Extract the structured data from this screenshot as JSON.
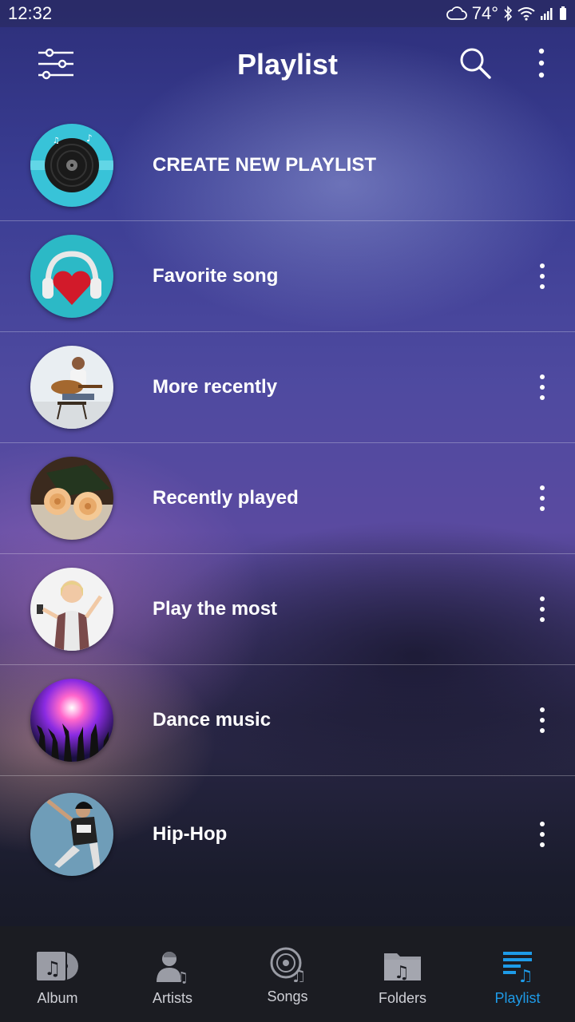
{
  "status_bar": {
    "time": "12:32",
    "temperature": "74°"
  },
  "header": {
    "title": "Playlist"
  },
  "playlists": [
    {
      "label": "CREATE NEW PLAYLIST",
      "icon": "vinyl-record-icon",
      "has_menu": false
    },
    {
      "label": "Favorite song",
      "icon": "heart-headphones-icon",
      "has_menu": true
    },
    {
      "label": "More recently",
      "icon": "guitarist-photo",
      "has_menu": true
    },
    {
      "label": "Recently played",
      "icon": "roses-photo",
      "has_menu": true
    },
    {
      "label": "Play the most",
      "icon": "singer-photo",
      "has_menu": true
    },
    {
      "label": "Dance music",
      "icon": "dance-crowd-photo",
      "has_menu": true
    },
    {
      "label": "Hip-Hop",
      "icon": "hiphop-dancer-photo",
      "has_menu": true
    }
  ],
  "bottom_nav": [
    {
      "label": "Album",
      "icon": "album-icon",
      "active": false
    },
    {
      "label": "Artists",
      "icon": "artist-icon",
      "active": false
    },
    {
      "label": "Songs",
      "icon": "songs-disc-icon",
      "active": false
    },
    {
      "label": "Folders",
      "icon": "folder-music-icon",
      "active": false
    },
    {
      "label": "Playlist",
      "icon": "playlist-icon",
      "active": true
    }
  ],
  "colors": {
    "accent": "#1e9be8",
    "nav_bg": "#1b1c22"
  }
}
